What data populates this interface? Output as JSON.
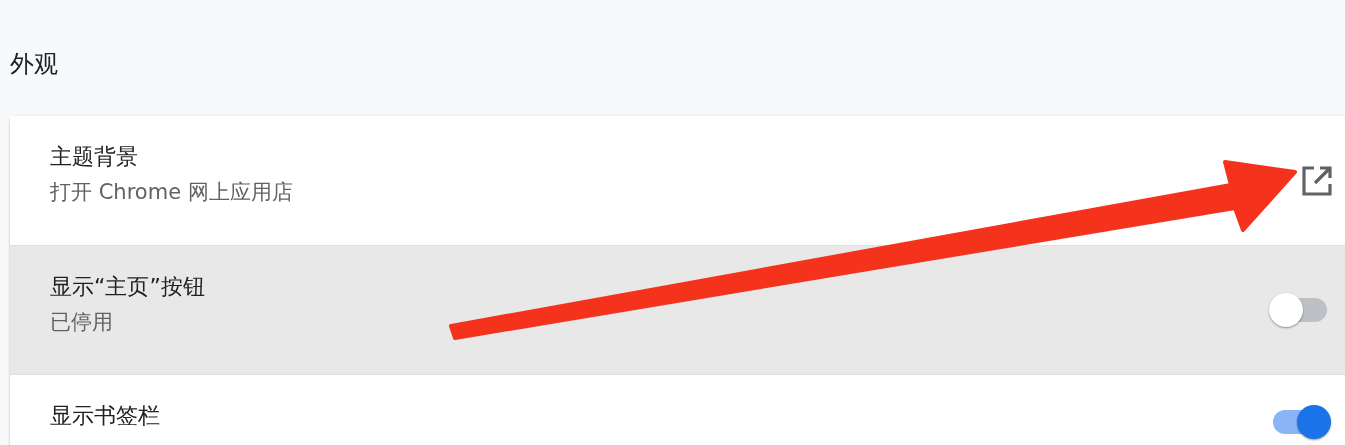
{
  "section": {
    "title": "外观"
  },
  "rows": [
    {
      "kind": "link",
      "title": "主题背景",
      "subtitle": "打开 Chrome 网上应用店",
      "highlighted": false
    },
    {
      "kind": "toggle",
      "title": "显示“主页”按钮",
      "subtitle": "已停用",
      "highlighted": true,
      "on": false
    },
    {
      "kind": "toggle",
      "title": "显示书签栏",
      "highlighted": false,
      "on": true
    }
  ]
}
